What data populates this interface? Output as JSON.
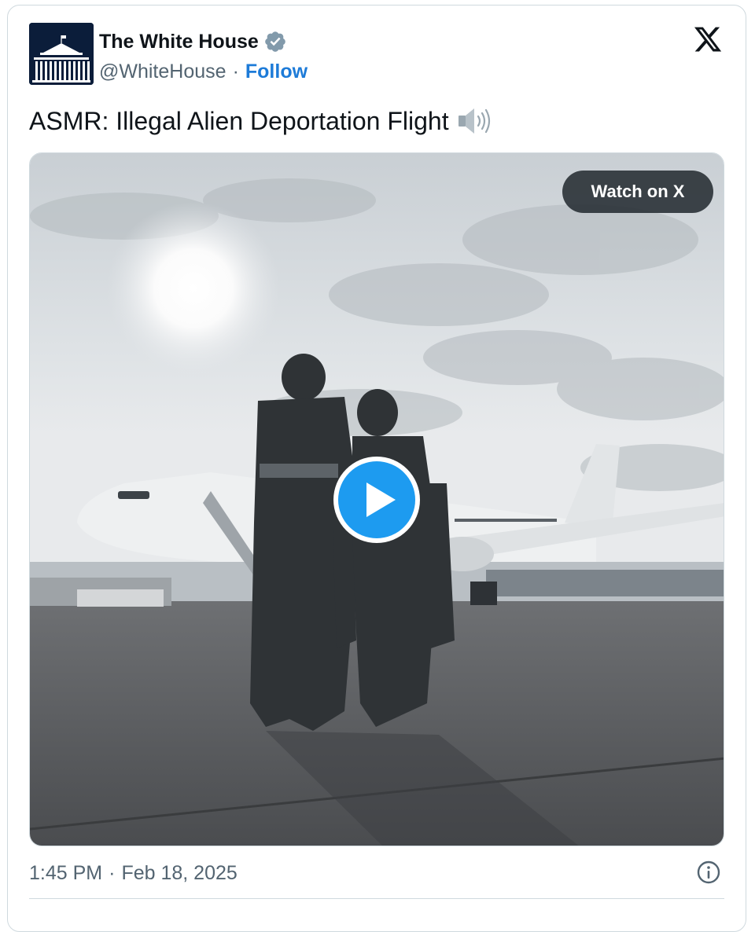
{
  "author": {
    "name": "The White House",
    "handle": "@WhiteHouse",
    "separator": "·",
    "follow_label": "Follow",
    "verified_icon": "verified-badge-icon",
    "avatar": "white-house-logo"
  },
  "brand": {
    "logo": "x-logo-icon"
  },
  "tweet": {
    "text": "ASMR: Illegal Alien Deportation Flight",
    "emoji_icon": "speaker-high-volume-icon"
  },
  "media": {
    "watch_label": "Watch on X",
    "play_icon": "play-icon",
    "description_icons": [
      "sun",
      "cloudy-sky",
      "airplane",
      "people",
      "tarmac"
    ]
  },
  "footer": {
    "time": "1:45 PM",
    "separator": "·",
    "date": "Feb 18, 2025",
    "info_icon": "info-icon"
  },
  "colors": {
    "accent": "#1d7bd8",
    "text": "#0f1419",
    "muted": "#536471",
    "border": "#cfd9de",
    "play_blue": "#1d9bf0"
  }
}
